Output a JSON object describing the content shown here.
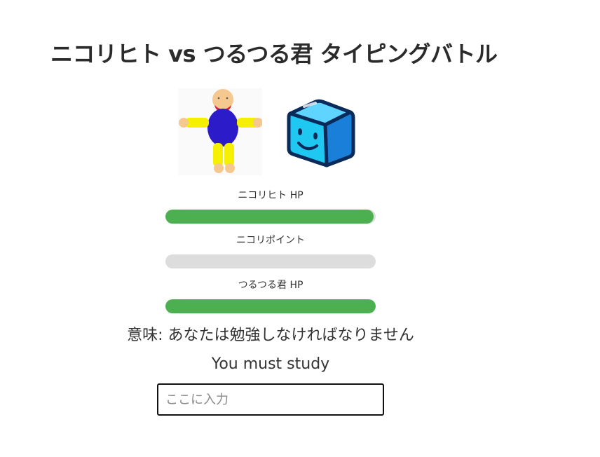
{
  "title": "ニコリヒト vs つるつる君 タイピングバトル",
  "player": {
    "image": "nikori-hito-character"
  },
  "enemy": {
    "image": "tsurutsuru-cube-character"
  },
  "bars": [
    {
      "label": "ニコリヒト HP",
      "fill_fraction": 0.99,
      "color": "#4caf50"
    },
    {
      "label": "ニコリポイント",
      "fill_fraction": 0.0,
      "color": "#4caf50"
    },
    {
      "label": "つるつる君 HP",
      "fill_fraction": 1.0,
      "color": "#4caf50"
    }
  ],
  "meaning": "意味: あなたは勉強しなければなりません",
  "phrase": "You must study",
  "input": {
    "placeholder": "ここに入力",
    "value": ""
  }
}
